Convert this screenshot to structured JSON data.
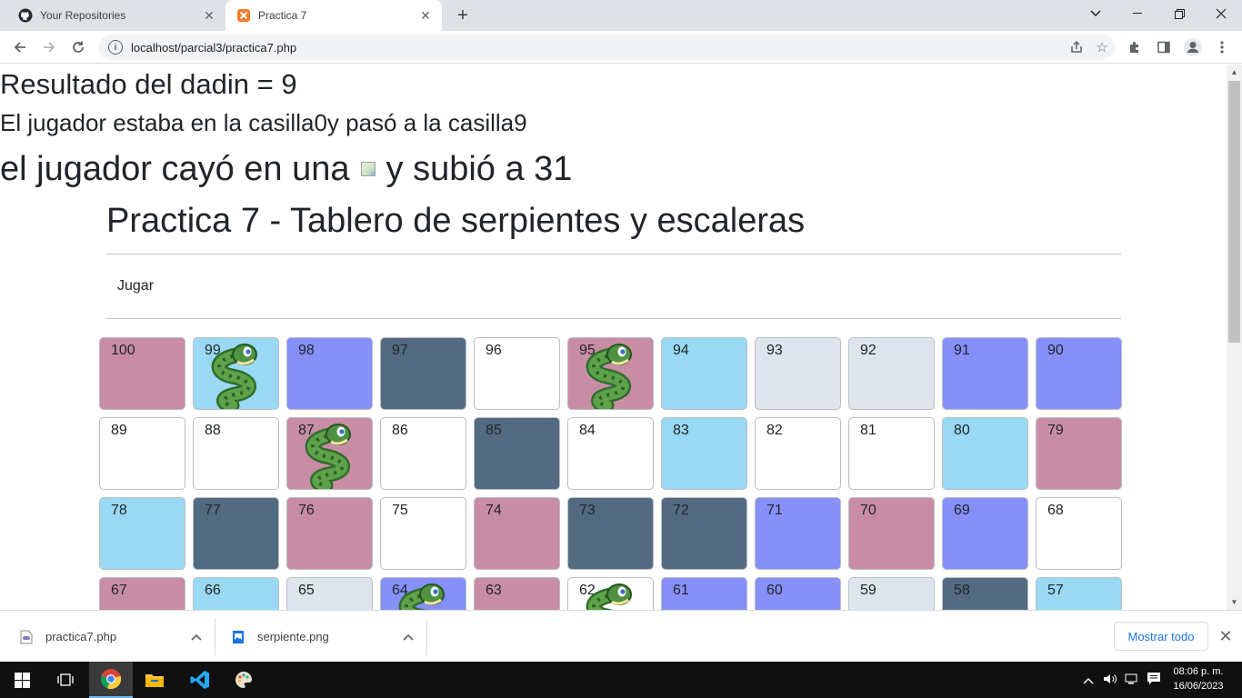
{
  "browser": {
    "tabs": [
      {
        "title": "Your Repositories",
        "icon": "github-icon"
      },
      {
        "title": "Practica 7",
        "icon": "xampp-icon"
      }
    ],
    "url": "localhost/parcial3/practica7.php"
  },
  "page": {
    "result_line": "Resultado del dadin = 9",
    "move_line": "El jugador estaba en la casilla0y pasó a la casilla9",
    "event_prefix": "el jugador cayó en una",
    "event_suffix": "y subió a 31",
    "title": "Practica 7 - Tablero de serpientes y escaleras",
    "play_button": "Jugar"
  },
  "board": {
    "rows": [
      [
        {
          "n": "100",
          "color": "pink"
        },
        {
          "n": "99",
          "color": "sky",
          "snake": true
        },
        {
          "n": "98",
          "color": "blue"
        },
        {
          "n": "97",
          "color": "slate"
        },
        {
          "n": "96",
          "color": "white"
        },
        {
          "n": "95",
          "color": "pink",
          "snake": true
        },
        {
          "n": "94",
          "color": "sky"
        },
        {
          "n": "93",
          "color": "gray"
        },
        {
          "n": "92",
          "color": "gray"
        },
        {
          "n": "91",
          "color": "blue"
        },
        {
          "n": "90",
          "color": "blue"
        }
      ],
      [
        {
          "n": "89",
          "color": "white"
        },
        {
          "n": "88",
          "color": "white"
        },
        {
          "n": "87",
          "color": "pink",
          "snake": true
        },
        {
          "n": "86",
          "color": "white"
        },
        {
          "n": "85",
          "color": "slate"
        },
        {
          "n": "84",
          "color": "white"
        },
        {
          "n": "83",
          "color": "sky"
        },
        {
          "n": "82",
          "color": "white"
        },
        {
          "n": "81",
          "color": "white"
        },
        {
          "n": "80",
          "color": "sky"
        },
        {
          "n": "79",
          "color": "pink"
        }
      ],
      [
        {
          "n": "78",
          "color": "sky"
        },
        {
          "n": "77",
          "color": "slate"
        },
        {
          "n": "76",
          "color": "pink"
        },
        {
          "n": "75",
          "color": "white"
        },
        {
          "n": "74",
          "color": "pink"
        },
        {
          "n": "73",
          "color": "slate"
        },
        {
          "n": "72",
          "color": "slate"
        },
        {
          "n": "71",
          "color": "blue"
        },
        {
          "n": "70",
          "color": "pink"
        },
        {
          "n": "69",
          "color": "blue"
        },
        {
          "n": "68",
          "color": "white"
        }
      ],
      [
        {
          "n": "67",
          "color": "pink"
        },
        {
          "n": "66",
          "color": "sky"
        },
        {
          "n": "65",
          "color": "gray"
        },
        {
          "n": "64",
          "color": "blue",
          "snake": true
        },
        {
          "n": "63",
          "color": "pink"
        },
        {
          "n": "62",
          "color": "white",
          "snake": true
        },
        {
          "n": "61",
          "color": "blue"
        },
        {
          "n": "60",
          "color": "blue"
        },
        {
          "n": "59",
          "color": "gray"
        },
        {
          "n": "58",
          "color": "slate"
        },
        {
          "n": "57",
          "color": "sky"
        }
      ]
    ]
  },
  "downloads": {
    "items": [
      {
        "name": "practica7.php",
        "icon": "php-file-icon"
      },
      {
        "name": "serpiente.png",
        "icon": "image-file-icon"
      }
    ],
    "show_all": "Mostrar todo"
  },
  "taskbar": {
    "time": "08:06 p. m.",
    "date": "16/06/2023"
  },
  "colors": {
    "pink": "#c88da5",
    "sky": "#9ad9f3",
    "blue": "#8590f9",
    "slate": "#536b80",
    "white": "#ffffff",
    "gray": "#dde4ec",
    "accent": "#1a73e8"
  }
}
